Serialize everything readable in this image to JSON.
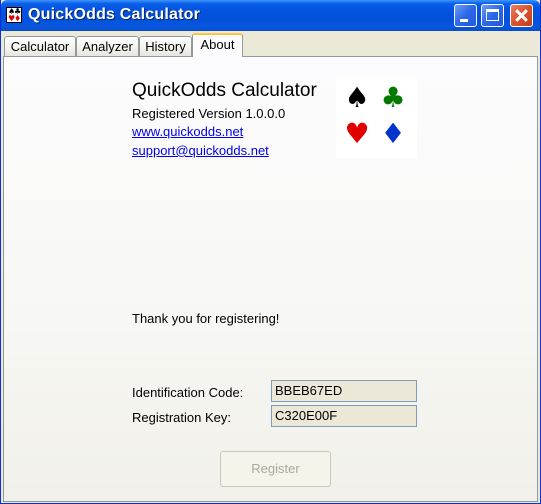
{
  "window": {
    "title": "QuickOdds Calculator"
  },
  "tabs": [
    {
      "label": "Calculator"
    },
    {
      "label": "Analyzer"
    },
    {
      "label": "History"
    },
    {
      "label": "About"
    }
  ],
  "about": {
    "app_name": "QuickOdds Calculator",
    "version": "Registered Version 1.0.0.0",
    "website": "www.quickodds.net",
    "support_email": "support@quickodds.net",
    "suits": {
      "spade": "♠",
      "club": "♣",
      "heart": "♥",
      "diamond": "♦"
    },
    "suit_colors": {
      "spade": "#000000",
      "club": "#007a00",
      "heart": "#e00000",
      "diamond": "#0033cc"
    },
    "thanks_message": "Thank you for registering!",
    "identification_label": "Identification Code:",
    "identification_value": "BBEB67ED",
    "registration_label": "Registration Key:",
    "registration_value": "C320E00F",
    "register_button": "Register"
  }
}
